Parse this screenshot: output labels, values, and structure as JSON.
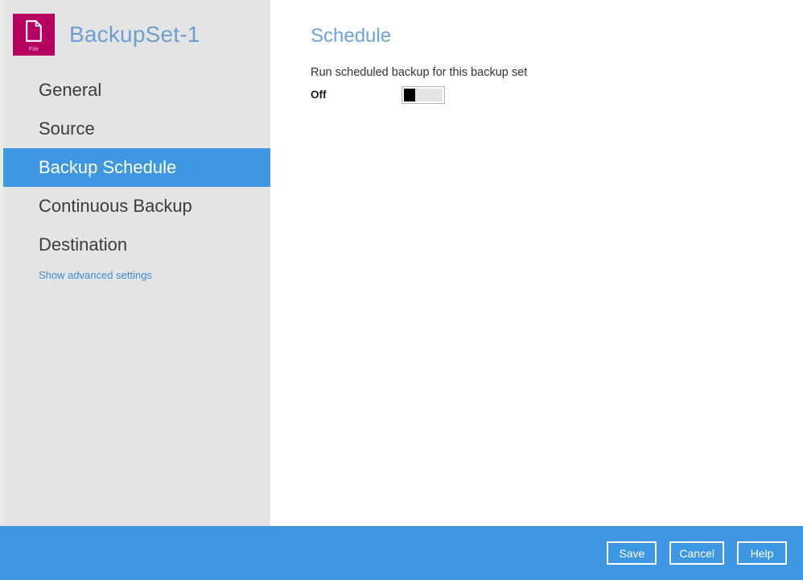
{
  "app": {
    "icon": {
      "name": "file-document-icon",
      "caption": "File",
      "background_color": "#b5005f"
    },
    "title": "BackupSet-1"
  },
  "sidebar": {
    "background_color": "#e4e4e4",
    "selected_color": "#3d97e3",
    "items": [
      {
        "label": "General",
        "selected": false
      },
      {
        "label": "Source",
        "selected": false
      },
      {
        "label": "Backup Schedule",
        "selected": true
      },
      {
        "label": "Continuous Backup",
        "selected": false
      },
      {
        "label": "Destination",
        "selected": false
      }
    ],
    "advanced_link": "Show advanced settings"
  },
  "content": {
    "title": "Schedule",
    "title_color": "#6ba3dd",
    "description": "Run scheduled backup for this backup set",
    "toggle": {
      "state_label": "Off",
      "checked": false
    }
  },
  "footer": {
    "background_color": "#3d97e3",
    "buttons": [
      {
        "label": "Save"
      },
      {
        "label": "Cancel"
      },
      {
        "label": "Help"
      }
    ]
  }
}
